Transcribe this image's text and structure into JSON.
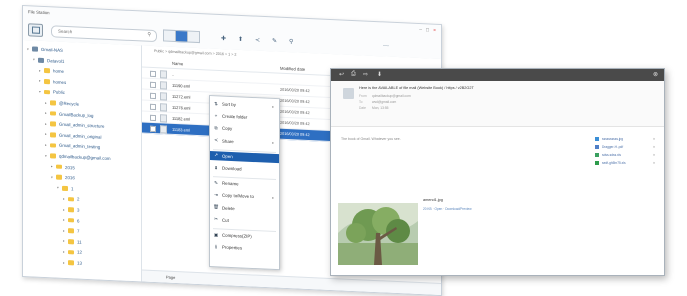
{
  "file_station": {
    "title": "File Station",
    "window_buttons": [
      "–",
      "□",
      "×"
    ],
    "search_placeholder": "Search",
    "toolbar": {
      "new_folder": "✚",
      "upload": "⬆",
      "share": "≺",
      "tools": "✎",
      "filter": "⚲",
      "more": "⋯"
    },
    "tree": [
      {
        "label": "Gmail-NAS",
        "indent": 0,
        "type": "nas",
        "arrow": "▾"
      },
      {
        "label": "Datavol1",
        "indent": 1,
        "type": "nas",
        "arrow": "▾"
      },
      {
        "label": "home",
        "indent": 2,
        "type": "folder",
        "arrow": "▸"
      },
      {
        "label": "homes",
        "indent": 2,
        "type": "folder",
        "arrow": "▸"
      },
      {
        "label": "Public",
        "indent": 2,
        "type": "folder",
        "arrow": "▾"
      },
      {
        "label": "@Recycle",
        "indent": 3,
        "type": "folder",
        "arrow": "▸"
      },
      {
        "label": "GmailBackup_log",
        "indent": 3,
        "type": "folder",
        "arrow": "▸"
      },
      {
        "label": "Gmail_admin_structure",
        "indent": 3,
        "type": "folder",
        "arrow": "▸"
      },
      {
        "label": "Gmail_admin_original",
        "indent": 3,
        "type": "folder",
        "arrow": "▸"
      },
      {
        "label": "Gmail_admin_testing",
        "indent": 3,
        "type": "folder",
        "arrow": "▸"
      },
      {
        "label": "qdmailbackup@gmail.com",
        "indent": 3,
        "type": "folder",
        "arrow": "▾"
      },
      {
        "label": "2015",
        "indent": 4,
        "type": "folder",
        "arrow": "▸"
      },
      {
        "label": "2016",
        "indent": 4,
        "type": "folder",
        "arrow": "▾"
      },
      {
        "label": "1",
        "indent": 5,
        "type": "folder",
        "arrow": "▾"
      },
      {
        "label": "2",
        "indent": 6,
        "type": "folder",
        "arrow": "▸"
      },
      {
        "label": "3",
        "indent": 6,
        "type": "folder",
        "arrow": "▸"
      },
      {
        "label": "6",
        "indent": 6,
        "type": "folder",
        "arrow": "▸"
      },
      {
        "label": "7",
        "indent": 6,
        "type": "folder",
        "arrow": "▸"
      },
      {
        "label": "11",
        "indent": 6,
        "type": "folder",
        "arrow": "▸"
      },
      {
        "label": "12",
        "indent": 6,
        "type": "folder",
        "arrow": "▸"
      },
      {
        "label": "13",
        "indent": 6,
        "type": "folder",
        "arrow": "▸"
      }
    ],
    "breadcrumb": "Public > qdmailbackup@gmail.com > 2016 > 1 > 2",
    "columns": {
      "name": "Name",
      "modified": "Modified date"
    },
    "files": [
      {
        "name": "..",
        "date": "",
        "selected": false
      },
      {
        "name": "11190.eml",
        "date": "2016/03/20 09:42",
        "selected": false
      },
      {
        "name": "11272.eml",
        "date": "2016/03/20 09:42",
        "selected": false
      },
      {
        "name": "11276.eml",
        "date": "2016/03/20 09:42",
        "selected": false
      },
      {
        "name": "11182.eml",
        "date": "2016/03/20 09:42",
        "selected": false
      },
      {
        "name": "11183.eml",
        "date": "2016/03/20 09:42",
        "selected": true
      }
    ],
    "footer_page": "Page"
  },
  "context_menu": [
    {
      "icon": "⇅",
      "label": "Sort by",
      "has_sub": true,
      "highlight": false
    },
    {
      "icon": "+",
      "label": "Create folder",
      "has_sub": false,
      "highlight": false
    },
    {
      "icon": "⧉",
      "label": "Copy",
      "has_sub": false,
      "highlight": false
    },
    {
      "icon": "≺",
      "label": "Share",
      "has_sub": true,
      "highlight": false
    },
    {
      "icon": "↗",
      "label": "Open",
      "has_sub": false,
      "highlight": true
    },
    {
      "icon": "⬇",
      "label": "Download",
      "has_sub": false,
      "highlight": false
    },
    {
      "icon": "✎",
      "label": "Rename",
      "has_sub": false,
      "highlight": false
    },
    {
      "icon": "⇥",
      "label": "Copy to/Move to",
      "has_sub": true,
      "highlight": false
    },
    {
      "icon": "🗑",
      "label": "Delete",
      "has_sub": false,
      "highlight": false
    },
    {
      "icon": "✂",
      "label": "Cut",
      "has_sub": false,
      "highlight": false
    },
    {
      "icon": "▣",
      "label": "Compress(ZIP)",
      "has_sub": false,
      "highlight": false
    },
    {
      "icon": "ℹ",
      "label": "Properties",
      "has_sub": false,
      "highlight": false
    }
  ],
  "mail_viewer": {
    "toolbar_icons": [
      "↩",
      "⎙",
      "⇨",
      "⬇"
    ],
    "close": "⊗",
    "subject": "Here is the AVAILABLE of file mail (Website Book) / https / v2B2G2T",
    "meta": [
      {
        "key": "From",
        "value": "qdmailbackup@gmail.com"
      },
      {
        "key": "To",
        "value": "wsd@gmail.com"
      },
      {
        "key": "Date",
        "value": "Mon, 13:55"
      }
    ],
    "body_text": "The book of Gmail. Whatever you see.",
    "attachments": [
      {
        "name": "ssssssssss.jpg",
        "color": "#3b8fd6"
      },
      {
        "name": "Dragger-H..pdf",
        "color": "#4f7fc7"
      },
      {
        "name": "sdss-sdss.xls",
        "color": "#3aa060"
      },
      {
        "name": "sedf-gh5hr75.xls",
        "color": "#2e9c4c"
      }
    ],
    "photo": {
      "name": "amend1.jpg",
      "size": "20 KB",
      "links": [
        "Open",
        "Download/Preview"
      ]
    }
  }
}
